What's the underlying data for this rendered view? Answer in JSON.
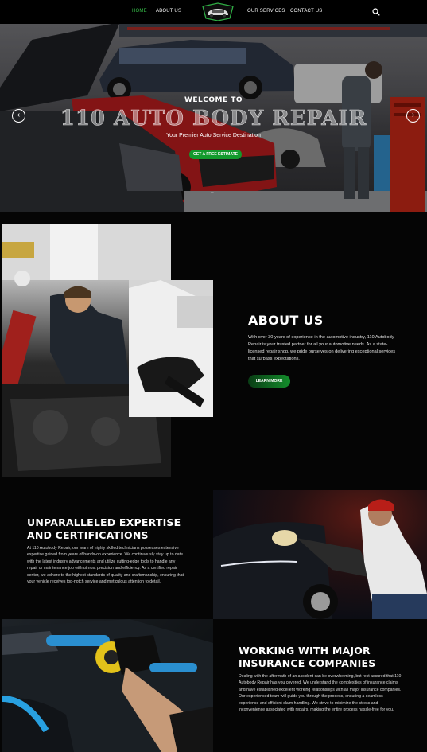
{
  "nav": {
    "items": [
      {
        "label": "HOME",
        "active": true
      },
      {
        "label": "ABOUT US",
        "active": false
      },
      {
        "label": "OUR SERVICES",
        "active": false
      },
      {
        "label": "CONTACT US",
        "active": false
      }
    ],
    "logo_icon": "car-emblem-logo",
    "search_icon": "search-icon",
    "active_color": "#37c24a"
  },
  "hero": {
    "welcome": "WELCOME TO",
    "title": "110 AUTO BODY REPAIR",
    "subtitle": "Your Premier Auto Service Destination",
    "cta_label": "GET A FREE ESTIMATE",
    "prev_icon": "chevron-left-icon",
    "next_icon": "chevron-right-icon",
    "scroll_icon": "chevron-down-icon",
    "accent": "#129a2c"
  },
  "about": {
    "title": "ABOUT US",
    "text": "With over 30 years of experience in the automotive industry, 110 Autobody Repair is your trusted partner for all your automotive needs. As a state-licensed repair shop, we pride ourselves on delivering exceptional services that surpass expectations.",
    "button_label": "LEARN MORE"
  },
  "expertise": {
    "title": "UNPARALLELED EXPERTISE AND CERTIFICATIONS",
    "text": "At 110 Autobody Repair, our team of highly skilled technicians possesses extensive expertise gained from years of hands-on experience. We continuously stay up to date with the latest industry advancements and utilize cutting-edge tools to handle any repair or maintenance job with utmost precision and efficiency. As a certified repair center, we adhere to the highest standards of quality and craftsmanship, ensuring that your vehicle receives top-notch service and meticulous attention to detail."
  },
  "insurance": {
    "title": "WORKING WITH MAJOR INSURANCE COMPANIES",
    "text": "Dealing with the aftermath of an accident can be overwhelming, but rest assured that 110 Autobody Repair has you covered. We understand the complexities of insurance claims and have established excellent working relationships with all major insurance companies. Our experienced team will guide you through the process, ensuring a seamless experience and efficient claim handling. We strive to minimize the stress and inconvenience associated with repairs, making the entire process hassle-free for you."
  }
}
